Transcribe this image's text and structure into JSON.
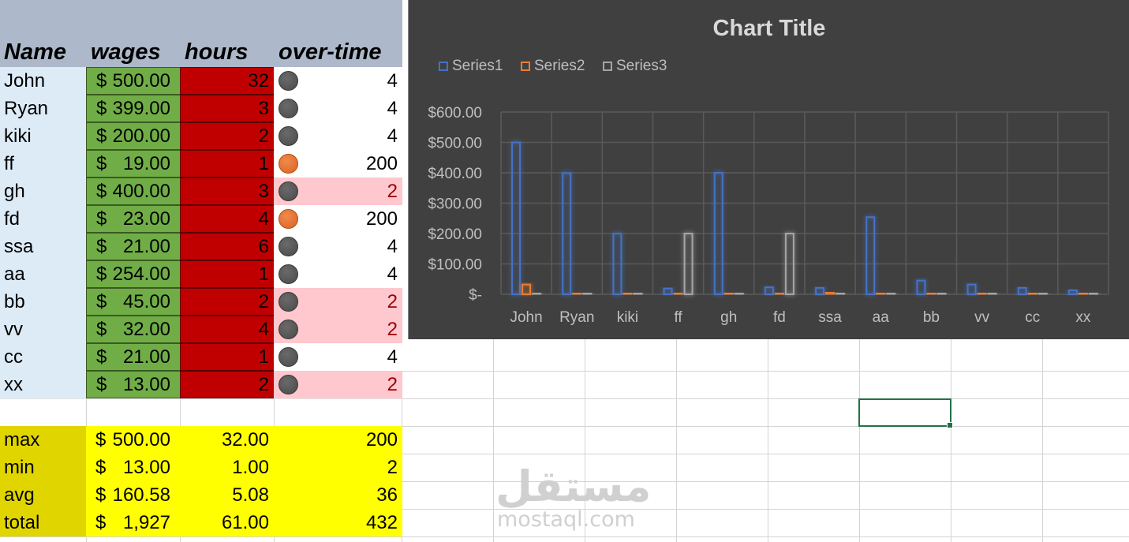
{
  "table": {
    "headers": {
      "name": "Name",
      "wages": "wages",
      "hours": "hours",
      "overtime": "over-time"
    },
    "currency_symbol": "$",
    "rows": [
      {
        "name": "John",
        "wage": "500.00",
        "hours": "32",
        "overtime": "4",
        "ot_status": "gray",
        "ot_low": false
      },
      {
        "name": "Ryan",
        "wage": "399.00",
        "hours": "3",
        "overtime": "4",
        "ot_status": "gray",
        "ot_low": false
      },
      {
        "name": "kiki",
        "wage": "200.00",
        "hours": "2",
        "overtime": "4",
        "ot_status": "gray",
        "ot_low": false
      },
      {
        "name": "ff",
        "wage": "19.00",
        "hours": "1",
        "overtime": "200",
        "ot_status": "orange",
        "ot_low": false
      },
      {
        "name": "gh",
        "wage": "400.00",
        "hours": "3",
        "overtime": "2",
        "ot_status": "gray",
        "ot_low": true
      },
      {
        "name": "fd",
        "wage": "23.00",
        "hours": "4",
        "overtime": "200",
        "ot_status": "orange",
        "ot_low": false
      },
      {
        "name": "ssa",
        "wage": "21.00",
        "hours": "6",
        "overtime": "4",
        "ot_status": "gray",
        "ot_low": false
      },
      {
        "name": "aa",
        "wage": "254.00",
        "hours": "1",
        "overtime": "4",
        "ot_status": "gray",
        "ot_low": false
      },
      {
        "name": "bb",
        "wage": "45.00",
        "hours": "2",
        "overtime": "2",
        "ot_status": "gray",
        "ot_low": true
      },
      {
        "name": "vv",
        "wage": "32.00",
        "hours": "4",
        "overtime": "2",
        "ot_status": "gray",
        "ot_low": true
      },
      {
        "name": "cc",
        "wage": "21.00",
        "hours": "1",
        "overtime": "4",
        "ot_status": "gray",
        "ot_low": false
      },
      {
        "name": "xx",
        "wage": "13.00",
        "hours": "2",
        "overtime": "2",
        "ot_status": "gray",
        "ot_low": true
      }
    ]
  },
  "stats": [
    {
      "label": "max",
      "wage": "500.00",
      "hours": "32.00",
      "overtime": "200"
    },
    {
      "label": "min",
      "wage": "13.00",
      "hours": "1.00",
      "overtime": "2"
    },
    {
      "label": "avg",
      "wage": "160.58",
      "hours": "5.08",
      "overtime": "36"
    },
    {
      "label": "total",
      "wage": "1,927",
      "hours": "61.00",
      "overtime": "432"
    }
  ],
  "colors": {
    "header_band": "#adb9ca",
    "name_fill": "#ddebf7",
    "wage_fill": "#70ad47",
    "hours_fill": "#c00000",
    "low_fill": "#ffc7ce",
    "stat_fill": "#ffff00",
    "chart_bg": "#404040",
    "series1": "#4472c4",
    "series2": "#ed7d31",
    "series3": "#a5a5a5"
  },
  "watermark": {
    "arabic": "مستقل",
    "latin": "mostaql.com"
  },
  "chart_data": {
    "type": "bar",
    "title": "Chart Title",
    "legend_position": "top-left",
    "grid": true,
    "categories": [
      "John",
      "Ryan",
      "kiki",
      "ff",
      "gh",
      "fd",
      "ssa",
      "aa",
      "bb",
      "vv",
      "cc",
      "xx"
    ],
    "series": [
      {
        "name": "Series1",
        "values": [
          500,
          399,
          200,
          19,
          400,
          23,
          21,
          254,
          45,
          32,
          21,
          13
        ]
      },
      {
        "name": "Series2",
        "values": [
          32,
          3,
          2,
          1,
          3,
          4,
          6,
          1,
          2,
          4,
          1,
          2
        ]
      },
      {
        "name": "Series3",
        "values": [
          4,
          4,
          4,
          200,
          2,
          200,
          4,
          4,
          2,
          2,
          4,
          2
        ]
      }
    ],
    "ylim": [
      0,
      600
    ],
    "yticks": [
      {
        "value": 0,
        "label": "$-"
      },
      {
        "value": 100,
        "label": "$100.00"
      },
      {
        "value": 200,
        "label": "$200.00"
      },
      {
        "value": 300,
        "label": "$300.00"
      },
      {
        "value": 400,
        "label": "$400.00"
      },
      {
        "value": 500,
        "label": "$500.00"
      },
      {
        "value": 600,
        "label": "$600.00"
      }
    ]
  }
}
